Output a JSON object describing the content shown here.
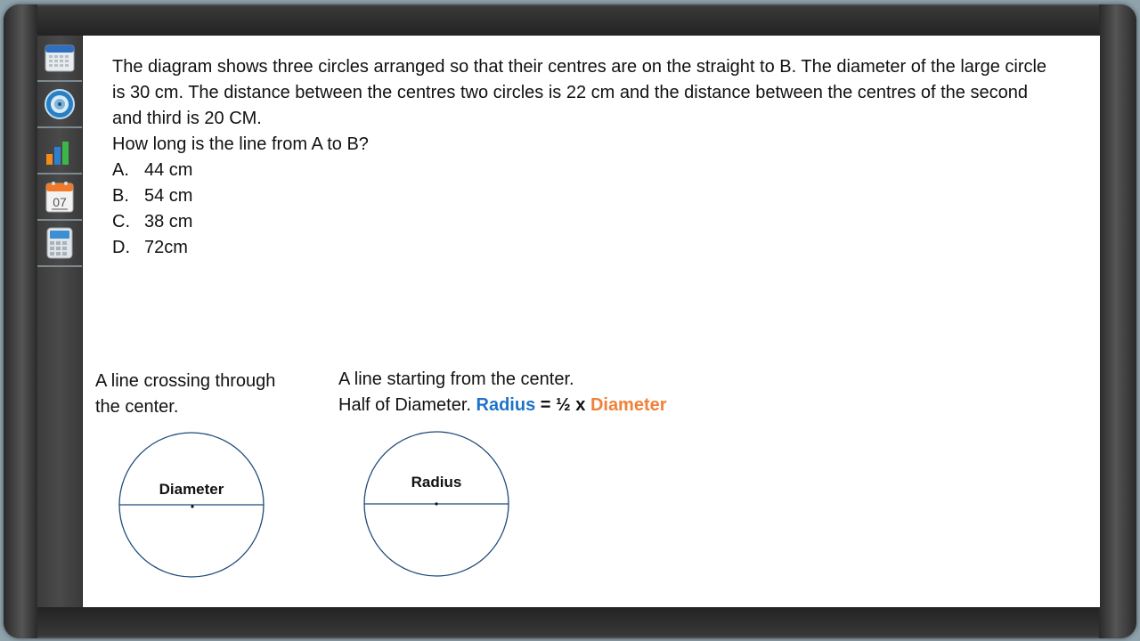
{
  "sidebar": {
    "items": [
      {
        "name": "calendar-grid-icon"
      },
      {
        "name": "timer-icon"
      },
      {
        "name": "bar-chart-icon"
      },
      {
        "name": "calendar-date-icon",
        "label": "07"
      },
      {
        "name": "calculator-icon"
      }
    ]
  },
  "question": {
    "paragraph": "The diagram shows three circles arranged so that their centres are on the straight to B. The diameter of the large circle is 30 cm. The distance between the centres two circles is 22 cm and the distance between the centres of the second and third is 20 CM.",
    "prompt": "How long is the line from A to B?",
    "options": [
      {
        "letter": "A.",
        "text": "44 cm"
      },
      {
        "letter": "B.",
        "text": "54 cm"
      },
      {
        "letter": "C.",
        "text": "38 cm"
      },
      {
        "letter": "D.",
        "text": "72cm"
      }
    ]
  },
  "diameter_section": {
    "caption_line1": "A line crossing through",
    "caption_line2": "the center.",
    "circle_label": "Diameter"
  },
  "radius_section": {
    "caption_line1": "A line starting from the center.",
    "caption_line2": "Half of Diameter.",
    "formula_radius": "Radius",
    "formula_middle": "= ½ x",
    "formula_diameter": "Diameter",
    "circle_label": "Radius"
  },
  "colors": {
    "radius": "#1f73c6",
    "diameter": "#f0813a",
    "circle_line": "#1e4b78"
  }
}
